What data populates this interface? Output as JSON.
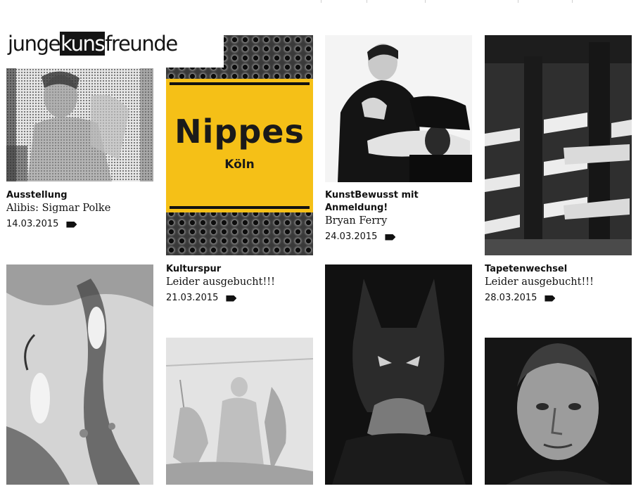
{
  "site": {
    "logo_pre": "junge",
    "logo_hl": "kuns",
    "logo_post": "freunde"
  },
  "tiles": [
    {
      "image": "polke-halftone-portrait",
      "title": "Ausstellung",
      "subtitle": "Alibis: Sigmar Polke",
      "date": "14.03.2015"
    },
    {
      "image": "nippes-town-sign",
      "sign_main": "Nippes",
      "sign_sub": "Köln",
      "title": "Kulturspur",
      "subtitle": "Leider ausgebucht!!!",
      "date": "21.03.2015"
    },
    {
      "image": "bryan-ferry-photo",
      "title": "KunstBewusst mit Anmeldung!",
      "subtitle": "Bryan Ferry",
      "date": "24.03.2015"
    },
    {
      "image": "theater-balconies-photo",
      "title": "Tapetenwechsel",
      "subtitle": "Leider ausgebucht!!!",
      "date": "28.03.2015"
    },
    {
      "image": "engraving-figures-tree"
    },
    {
      "image": "baroque-drawing"
    },
    {
      "image": "batman-portrait"
    },
    {
      "image": "werner-herzog-portrait"
    }
  ],
  "icons": {
    "date_tag": "tag-icon"
  },
  "colors": {
    "sign_yellow": "#f5c017",
    "text": "#111111"
  }
}
